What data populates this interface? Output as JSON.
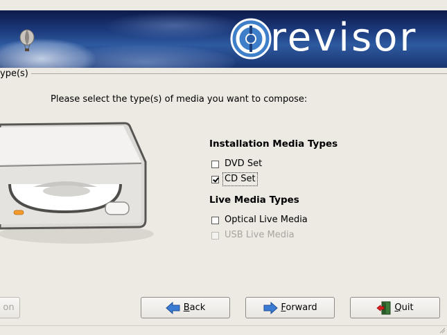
{
  "banner": {
    "logo_text": "revisor"
  },
  "frame": {
    "title": "ype(s)"
  },
  "prompt": "Please select the type(s) of media you want to compose:",
  "install_section": {
    "title": "Installation Media Types",
    "options": [
      {
        "label": "DVD Set",
        "checked": false
      },
      {
        "label": "CD Set",
        "checked": true
      }
    ]
  },
  "live_section": {
    "title": "Live Media Types",
    "options": [
      {
        "label": "Optical Live Media",
        "checked": false
      },
      {
        "label": "USB Live Media",
        "checked": false,
        "disabled": true
      }
    ]
  },
  "buttons": {
    "partial": "on",
    "back": {
      "mnemonic": "B",
      "rest": "ack"
    },
    "forward": {
      "mnemonic": "F",
      "rest": "orward"
    },
    "quit": {
      "mnemonic": "Q",
      "rest": "uit"
    }
  },
  "icons": [
    "balloon-icon",
    "revisor-logo-icon",
    "optical-drive-icon",
    "back-arrow-icon",
    "forward-arrow-icon",
    "quit-door-icon"
  ]
}
